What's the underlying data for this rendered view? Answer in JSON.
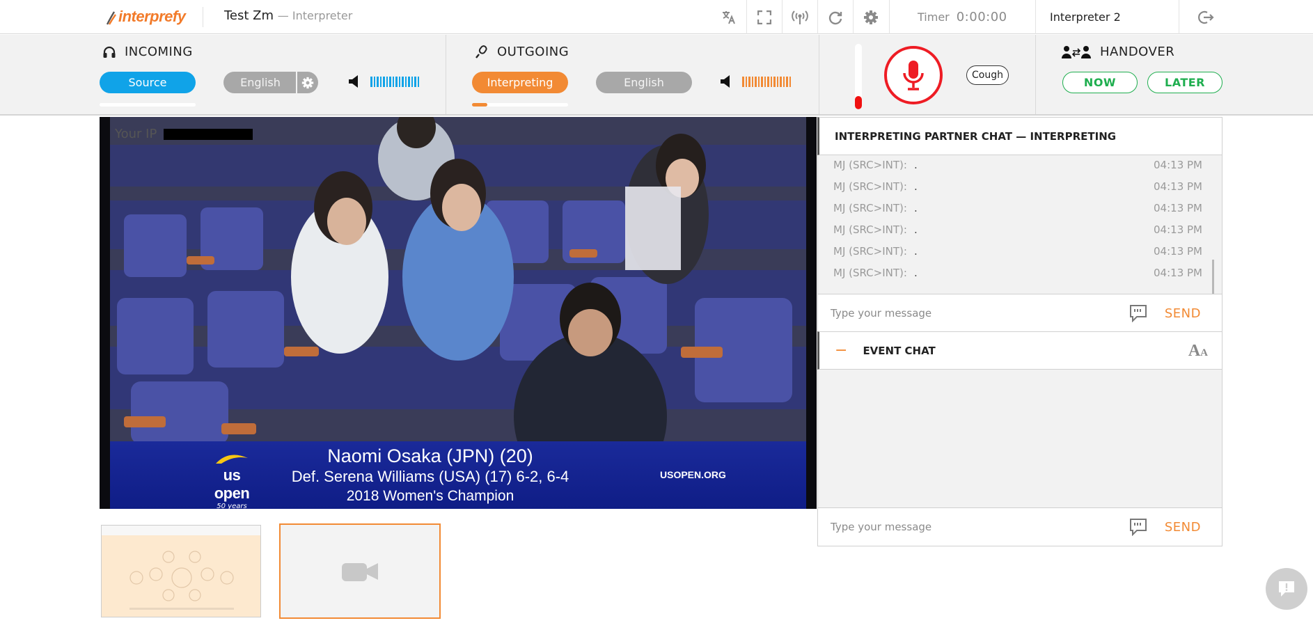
{
  "header": {
    "logo_text": "interprefy",
    "session_name": "Test Zm",
    "session_role": "— Interpreter",
    "timer_label": "Timer",
    "timer_value": "0:00:00",
    "user_name": "Interpreter 2",
    "icons": [
      "translate-icon",
      "fullscreen-icon",
      "broadcast-icon",
      "refresh-icon",
      "gear-icon",
      "logout-icon"
    ]
  },
  "incoming": {
    "title": "INCOMING",
    "source_button": "Source",
    "language_button": "English",
    "source_level": 1.0
  },
  "outgoing": {
    "title": "OUTGOING",
    "interpreting_button": "Interpreting",
    "language_button": "English",
    "interpreting_level": 0.16
  },
  "microphone": {
    "input_level": 0.2,
    "cough_label": "Cough",
    "mic_color": "#ee1c24"
  },
  "handover": {
    "title": "HANDOVER",
    "now_label": "NOW",
    "later_label": "LATER"
  },
  "video": {
    "ip_label": "Your IP",
    "lower_third": {
      "brand": "us open",
      "brand_sub": "50 years",
      "line1": "Naomi Osaka (JPN) (20)",
      "line2": "Def. Serena Williams (USA) (17) 6-2, 6-4",
      "line3": "2018 Women's Champion",
      "site": "USOPEN.ORG"
    }
  },
  "partner_chat": {
    "title": "INTERPRETING PARTNER CHAT — INTERPRETING",
    "messages": [
      {
        "who": "MJ (SRC>INT):",
        "text": ".",
        "time": "04:13 PM"
      },
      {
        "who": "MJ (SRC>INT):",
        "text": ".",
        "time": "04:13 PM"
      },
      {
        "who": "MJ (SRC>INT):",
        "text": ".",
        "time": "04:13 PM"
      },
      {
        "who": "MJ (SRC>INT):",
        "text": ".",
        "time": "04:13 PM"
      },
      {
        "who": "MJ (SRC>INT):",
        "text": ".",
        "time": "04:13 PM"
      },
      {
        "who": "MJ (SRC>INT):",
        "text": ".",
        "time": "04:13 PM"
      }
    ],
    "input_placeholder": "Type your message",
    "send_label": "SEND"
  },
  "event_chat": {
    "toggle": "−",
    "title": "EVENT CHAT",
    "font_size_icon": "AA",
    "input_placeholder": "Type your message",
    "send_label": "SEND"
  },
  "colors": {
    "accent_orange": "#f28a34",
    "accent_blue": "#10a3e8",
    "handover_green": "#1fae4f",
    "mic_red": "#ee1c24"
  }
}
